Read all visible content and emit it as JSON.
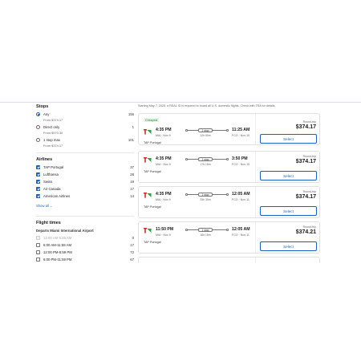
{
  "filters": {
    "stops": {
      "title": "Stops",
      "options": [
        {
          "label": "Any",
          "sub": "From $374.17",
          "count": "156",
          "selected": true
        },
        {
          "label": "Direct only",
          "sub": "From $570.30",
          "count": "1",
          "selected": false
        },
        {
          "label": "1 stop max",
          "sub": "From $374.17",
          "count": "101",
          "selected": false
        }
      ]
    },
    "airlines": {
      "title": "Airlines",
      "items": [
        {
          "label": "TAP Portugal",
          "count": "37"
        },
        {
          "label": "Lufthansa",
          "count": "28"
        },
        {
          "label": "Swiss",
          "count": "19"
        },
        {
          "label": "Air Canada",
          "count": "17"
        },
        {
          "label": "American Airlines",
          "count": "14"
        }
      ],
      "show_all": "Show all"
    },
    "flight_times": {
      "title": "Flight times",
      "subtitle": "Departs Miami International Airport",
      "slots": [
        {
          "label": "12:00 AM-5:59 AM",
          "count": "0",
          "disabled": true
        },
        {
          "label": "6:00 AM-11:59 AM",
          "count": "17",
          "disabled": false
        },
        {
          "label": "12:00 PM-5:59 PM",
          "count": "72",
          "disabled": false
        },
        {
          "label": "6:00 PM-11:59 PM",
          "count": "67",
          "disabled": false
        }
      ]
    }
  },
  "notice": "Starting May 7, 2025, a REAL ID is required to board all U.S. domestic flights. Check with TSA for details.",
  "flights": [
    {
      "badge": "Cheapest",
      "dep_time": "4:35 PM",
      "dep_code": "MIA · Nov 9",
      "stop": "1 stop",
      "duration": "12h 50m",
      "arr_time": "11:25 AM",
      "arr_code": "FCO · Nov 10",
      "airline": "TAP Portugal",
      "trip": "Round-trip",
      "price": "$374.17",
      "select": "Select"
    },
    {
      "badge": "",
      "dep_time": "4:35 PM",
      "dep_code": "MIA · Nov 9",
      "stop": "1 stop",
      "duration": "17h 15m",
      "arr_time": "3:50 PM",
      "arr_code": "FCO · Nov 10",
      "airline": "TAP Portugal",
      "trip": "Round-trip",
      "price": "$374.17",
      "select": "Select"
    },
    {
      "badge": "",
      "dep_time": "4:35 PM",
      "dep_code": "MIA · Nov 9",
      "stop": "1 stop",
      "duration": "25h 30m",
      "arr_time": "12:05 AM",
      "arr_code": "FCO · Nov 11",
      "airline": "TAP Portugal",
      "trip": "Round-trip",
      "price": "$374.17",
      "select": "Select"
    },
    {
      "badge": "",
      "dep_time": "11:50 PM",
      "dep_code": "MIA · Nov 9",
      "stop": "1 stop",
      "duration": "18h 15m",
      "arr_time": "12:05 AM",
      "arr_code": "FCO · Nov 11",
      "airline": "TAP Portugal",
      "trip": "Round-trip",
      "price": "$374.21",
      "select": "Select"
    }
  ],
  "colors": {
    "accent": "#1a63c5",
    "tap_green": "#2e9e3f",
    "tap_red": "#d62b2b"
  },
  "icons": {
    "airline_logo": "tap-logo-icon",
    "chevron": "chevron-down-icon"
  }
}
